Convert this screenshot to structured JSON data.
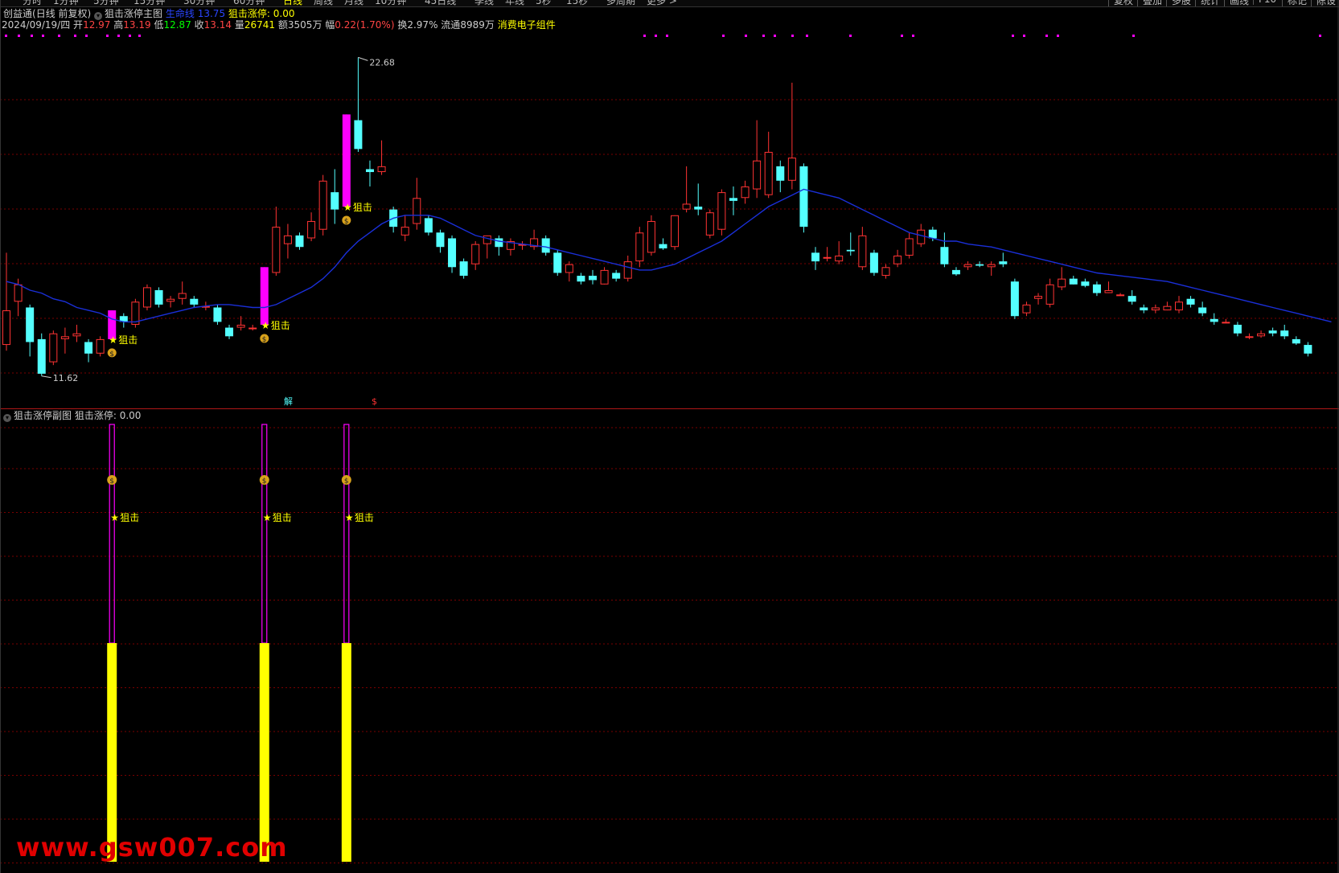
{
  "toolbar": {
    "tabs": [
      "分时",
      "1分钟",
      "5分钟",
      "15分钟",
      "30分钟",
      "60分钟",
      "日线",
      "周线",
      "月线",
      "10分钟",
      "45日线",
      "季线",
      "年线",
      "5秒",
      "15秒",
      "多周期",
      "更多 >"
    ],
    "active_tab": "日线",
    "right_buttons": [
      "复权",
      "叠加",
      "多股",
      "统计",
      "画线",
      "F10",
      "标记",
      "陈设"
    ]
  },
  "header": {
    "app": "创益通",
    "mode": "(日线 前复权)",
    "indicator": "狙击涨停主图",
    "lifeline_label": "生命线",
    "lifeline_value": "13.75",
    "signal_label": "狙击涨停:",
    "signal_value": "0.00",
    "date": "2024/09/19/四",
    "open_label": "开",
    "open": "12.97",
    "high_label": "高",
    "high": "13.19",
    "low_label": "低",
    "low": "12.87",
    "close_label": "收",
    "close": "13.14",
    "volume_label": "量",
    "volume": "26741",
    "amount_label": "额",
    "amount": "3505万",
    "change_label": "幅",
    "change": "0.22(1.70%)",
    "turnover_label": "换",
    "turnover": "2.97%",
    "float_label": "流通",
    "float": "8989万",
    "sector": "消费电子组件"
  },
  "sub_header": {
    "indicator": "狙击涨停副图",
    "signal_label": "狙击涨停:",
    "signal_value": "0.00"
  },
  "markers": {
    "jie": "解",
    "dollar": "$",
    "signal_text": "狙击",
    "star": "★",
    "max_price": "22.68",
    "min_price": "11.62"
  },
  "watermark": "www.gsw007.com",
  "colors": {
    "up": "#ff3333",
    "down": "#54ffff",
    "limit_up": "#ff00ff",
    "lifeline": "#1a2fd8",
    "signal_text": "#ffff00",
    "sub_bar": "#ffff00",
    "grid": "#7a0000"
  },
  "chart_data": {
    "type": "candlestick",
    "title": "狙击涨停主图",
    "ylim": [
      11.0,
      23.5
    ],
    "candles": [
      {
        "o": 12.7,
        "h": 15.9,
        "l": 12.5,
        "c": 13.9
      },
      {
        "o": 14.2,
        "h": 15.0,
        "l": 13.7,
        "c": 14.8
      },
      {
        "o": 14.0,
        "h": 14.1,
        "l": 12.3,
        "c": 12.8
      },
      {
        "o": 12.9,
        "h": 13.1,
        "l": 11.62,
        "c": 11.7
      },
      {
        "o": 12.1,
        "h": 13.2,
        "l": 12.0,
        "c": 13.1
      },
      {
        "o": 12.9,
        "h": 13.3,
        "l": 12.4,
        "c": 13.0
      },
      {
        "o": 13.0,
        "h": 13.4,
        "l": 12.8,
        "c": 13.1
      },
      {
        "o": 12.8,
        "h": 12.9,
        "l": 12.1,
        "c": 12.4
      },
      {
        "o": 12.4,
        "h": 13.0,
        "l": 12.3,
        "c": 12.9
      },
      {
        "o": 12.9,
        "h": 13.9,
        "l": 12.8,
        "c": 13.9,
        "limit": true
      },
      {
        "o": 13.7,
        "h": 13.8,
        "l": 13.3,
        "c": 13.5
      },
      {
        "o": 13.4,
        "h": 14.3,
        "l": 13.3,
        "c": 14.2
      },
      {
        "o": 14.0,
        "h": 14.8,
        "l": 13.9,
        "c": 14.7
      },
      {
        "o": 14.6,
        "h": 14.7,
        "l": 14.0,
        "c": 14.1
      },
      {
        "o": 14.2,
        "h": 14.4,
        "l": 14.0,
        "c": 14.3
      },
      {
        "o": 14.3,
        "h": 14.9,
        "l": 14.1,
        "c": 14.5
      },
      {
        "o": 14.3,
        "h": 14.4,
        "l": 14.0,
        "c": 14.1
      },
      {
        "o": 14.0,
        "h": 14.2,
        "l": 13.9,
        "c": 14.05
      },
      {
        "o": 14.0,
        "h": 14.1,
        "l": 13.4,
        "c": 13.5
      },
      {
        "o": 13.3,
        "h": 13.4,
        "l": 12.9,
        "c": 13.0
      },
      {
        "o": 13.3,
        "h": 13.7,
        "l": 13.2,
        "c": 13.4
      },
      {
        "o": 13.3,
        "h": 13.4,
        "l": 13.2,
        "c": 13.3
      },
      {
        "o": 13.4,
        "h": 15.4,
        "l": 13.3,
        "c": 15.4,
        "limit": true
      },
      {
        "o": 15.2,
        "h": 17.5,
        "l": 15.1,
        "c": 16.8
      },
      {
        "o": 16.2,
        "h": 16.9,
        "l": 15.7,
        "c": 16.5
      },
      {
        "o": 16.5,
        "h": 16.6,
        "l": 16.0,
        "c": 16.1
      },
      {
        "o": 16.4,
        "h": 17.3,
        "l": 16.3,
        "c": 17.0
      },
      {
        "o": 16.7,
        "h": 18.6,
        "l": 16.5,
        "c": 18.4
      },
      {
        "o": 18.0,
        "h": 18.8,
        "l": 16.9,
        "c": 17.4
      },
      {
        "o": 17.5,
        "h": 20.7,
        "l": 17.4,
        "c": 20.7,
        "limit": true
      },
      {
        "o": 20.5,
        "h": 22.68,
        "l": 19.4,
        "c": 19.5
      },
      {
        "o": 18.8,
        "h": 19.1,
        "l": 18.2,
        "c": 18.7
      },
      {
        "o": 18.7,
        "h": 19.8,
        "l": 18.6,
        "c": 18.9
      },
      {
        "o": 17.4,
        "h": 17.5,
        "l": 16.6,
        "c": 16.8
      },
      {
        "o": 16.5,
        "h": 17.2,
        "l": 16.3,
        "c": 16.8
      },
      {
        "o": 16.9,
        "h": 18.5,
        "l": 16.7,
        "c": 17.8
      },
      {
        "o": 17.1,
        "h": 17.2,
        "l": 16.5,
        "c": 16.6
      },
      {
        "o": 16.6,
        "h": 16.7,
        "l": 15.9,
        "c": 16.1
      },
      {
        "o": 16.4,
        "h": 16.5,
        "l": 15.2,
        "c": 15.4
      },
      {
        "o": 15.6,
        "h": 15.7,
        "l": 15.0,
        "c": 15.1
      },
      {
        "o": 15.5,
        "h": 16.3,
        "l": 15.3,
        "c": 16.2
      },
      {
        "o": 16.2,
        "h": 16.5,
        "l": 15.7,
        "c": 16.5
      },
      {
        "o": 16.4,
        "h": 16.5,
        "l": 15.8,
        "c": 16.1
      },
      {
        "o": 16.0,
        "h": 16.4,
        "l": 15.8,
        "c": 16.3
      },
      {
        "o": 16.2,
        "h": 16.3,
        "l": 16.0,
        "c": 16.2
      },
      {
        "o": 16.1,
        "h": 16.7,
        "l": 16.0,
        "c": 16.4
      },
      {
        "o": 16.4,
        "h": 16.5,
        "l": 15.8,
        "c": 15.9
      },
      {
        "o": 15.9,
        "h": 16.0,
        "l": 15.1,
        "c": 15.2
      },
      {
        "o": 15.2,
        "h": 15.6,
        "l": 14.9,
        "c": 15.5
      },
      {
        "o": 15.1,
        "h": 15.2,
        "l": 14.8,
        "c": 14.9
      },
      {
        "o": 15.1,
        "h": 15.3,
        "l": 14.8,
        "c": 14.95
      },
      {
        "o": 14.8,
        "h": 15.4,
        "l": 14.8,
        "c": 15.3
      },
      {
        "o": 15.2,
        "h": 15.3,
        "l": 14.9,
        "c": 15.0
      },
      {
        "o": 15.0,
        "h": 15.8,
        "l": 14.9,
        "c": 15.6
      },
      {
        "o": 15.6,
        "h": 16.8,
        "l": 15.4,
        "c": 16.6
      },
      {
        "o": 15.9,
        "h": 17.2,
        "l": 15.8,
        "c": 17.0
      },
      {
        "o": 16.2,
        "h": 16.4,
        "l": 16.0,
        "c": 16.05
      },
      {
        "o": 16.1,
        "h": 17.2,
        "l": 16.0,
        "c": 17.2
      },
      {
        "o": 17.4,
        "h": 18.9,
        "l": 17.3,
        "c": 17.6
      },
      {
        "o": 17.5,
        "h": 18.3,
        "l": 17.2,
        "c": 17.4
      },
      {
        "o": 16.5,
        "h": 17.4,
        "l": 16.4,
        "c": 17.3
      },
      {
        "o": 16.7,
        "h": 18.1,
        "l": 16.5,
        "c": 18.0
      },
      {
        "o": 17.8,
        "h": 18.2,
        "l": 17.2,
        "c": 17.7
      },
      {
        "o": 17.8,
        "h": 18.4,
        "l": 17.6,
        "c": 18.2
      },
      {
        "o": 18.1,
        "h": 20.5,
        "l": 17.8,
        "c": 19.1
      },
      {
        "o": 17.9,
        "h": 20.1,
        "l": 17.8,
        "c": 19.4
      },
      {
        "o": 18.9,
        "h": 19.1,
        "l": 18.0,
        "c": 18.4
      },
      {
        "o": 18.4,
        "h": 21.8,
        "l": 18.1,
        "c": 19.2
      },
      {
        "o": 18.9,
        "h": 19.0,
        "l": 16.6,
        "c": 16.8
      },
      {
        "o": 15.9,
        "h": 16.1,
        "l": 15.3,
        "c": 15.6
      },
      {
        "o": 15.7,
        "h": 16.1,
        "l": 15.6,
        "c": 15.75
      },
      {
        "o": 15.6,
        "h": 16.3,
        "l": 15.5,
        "c": 15.8
      },
      {
        "o": 16.0,
        "h": 16.6,
        "l": 15.8,
        "c": 15.95
      },
      {
        "o": 15.4,
        "h": 16.8,
        "l": 15.3,
        "c": 16.5
      },
      {
        "o": 15.9,
        "h": 16.0,
        "l": 15.1,
        "c": 15.2
      },
      {
        "o": 15.1,
        "h": 15.5,
        "l": 15.0,
        "c": 15.4
      },
      {
        "o": 15.5,
        "h": 16.0,
        "l": 15.4,
        "c": 15.8
      },
      {
        "o": 15.8,
        "h": 16.6,
        "l": 15.7,
        "c": 16.4
      },
      {
        "o": 16.2,
        "h": 16.9,
        "l": 16.1,
        "c": 16.7
      },
      {
        "o": 16.7,
        "h": 16.8,
        "l": 16.3,
        "c": 16.4
      },
      {
        "o": 16.1,
        "h": 16.6,
        "l": 15.4,
        "c": 15.5
      },
      {
        "o": 15.3,
        "h": 15.4,
        "l": 15.1,
        "c": 15.15
      },
      {
        "o": 15.4,
        "h": 15.6,
        "l": 15.3,
        "c": 15.5
      },
      {
        "o": 15.5,
        "h": 15.6,
        "l": 15.4,
        "c": 15.45
      },
      {
        "o": 15.4,
        "h": 15.6,
        "l": 15.1,
        "c": 15.5
      },
      {
        "o": 15.6,
        "h": 15.9,
        "l": 15.4,
        "c": 15.5
      },
      {
        "o": 14.9,
        "h": 15.0,
        "l": 13.6,
        "c": 13.7
      },
      {
        "o": 13.8,
        "h": 14.2,
        "l": 13.7,
        "c": 14.1
      },
      {
        "o": 14.3,
        "h": 14.5,
        "l": 14.1,
        "c": 14.4
      },
      {
        "o": 14.1,
        "h": 15.0,
        "l": 14.0,
        "c": 14.8
      },
      {
        "o": 14.7,
        "h": 15.4,
        "l": 14.6,
        "c": 15.0
      },
      {
        "o": 15.0,
        "h": 15.1,
        "l": 14.8,
        "c": 14.8
      },
      {
        "o": 14.9,
        "h": 15.0,
        "l": 14.7,
        "c": 14.75
      },
      {
        "o": 14.8,
        "h": 14.9,
        "l": 14.4,
        "c": 14.5
      },
      {
        "o": 14.5,
        "h": 14.9,
        "l": 14.5,
        "c": 14.6
      },
      {
        "o": 14.4,
        "h": 14.5,
        "l": 14.4,
        "c": 14.45
      },
      {
        "o": 14.4,
        "h": 14.6,
        "l": 14.1,
        "c": 14.2
      },
      {
        "o": 14.0,
        "h": 14.1,
        "l": 13.8,
        "c": 13.9
      },
      {
        "o": 13.9,
        "h": 14.1,
        "l": 13.8,
        "c": 14.0
      },
      {
        "o": 13.9,
        "h": 14.2,
        "l": 13.9,
        "c": 14.05
      },
      {
        "o": 13.9,
        "h": 14.4,
        "l": 13.8,
        "c": 14.2
      },
      {
        "o": 14.3,
        "h": 14.4,
        "l": 14.0,
        "c": 14.1
      },
      {
        "o": 14.0,
        "h": 14.2,
        "l": 13.7,
        "c": 13.8
      },
      {
        "o": 13.6,
        "h": 13.8,
        "l": 13.4,
        "c": 13.5
      },
      {
        "o": 13.5,
        "h": 13.6,
        "l": 13.45,
        "c": 13.5
      },
      {
        "o": 13.4,
        "h": 13.5,
        "l": 13.0,
        "c": 13.1
      },
      {
        "o": 13.0,
        "h": 13.1,
        "l": 12.9,
        "c": 13.0
      },
      {
        "o": 13.0,
        "h": 13.2,
        "l": 12.95,
        "c": 13.1
      },
      {
        "o": 13.2,
        "h": 13.3,
        "l": 13.0,
        "c": 13.1
      },
      {
        "o": 13.2,
        "h": 13.4,
        "l": 12.9,
        "c": 13.0
      },
      {
        "o": 12.9,
        "h": 13.0,
        "l": 12.7,
        "c": 12.75
      },
      {
        "o": 12.7,
        "h": 12.8,
        "l": 12.3,
        "c": 12.4
      }
    ],
    "lifeline": [
      14.9,
      14.8,
      14.6,
      14.5,
      14.3,
      14.2,
      14.0,
      13.9,
      13.8,
      13.6,
      13.5,
      13.5,
      13.6,
      13.7,
      13.8,
      13.9,
      14.0,
      14.05,
      14.1,
      14.1,
      14.05,
      14.0,
      14.0,
      14.1,
      14.3,
      14.5,
      14.7,
      15.0,
      15.4,
      15.9,
      16.3,
      16.6,
      16.9,
      17.1,
      17.2,
      17.2,
      17.2,
      17.1,
      16.9,
      16.7,
      16.5,
      16.4,
      16.3,
      16.25,
      16.2,
      16.15,
      16.1,
      16.0,
      15.9,
      15.8,
      15.7,
      15.6,
      15.5,
      15.4,
      15.3,
      15.3,
      15.4,
      15.5,
      15.7,
      15.9,
      16.1,
      16.3,
      16.6,
      16.9,
      17.2,
      17.5,
      17.7,
      17.9,
      18.1,
      18.0,
      17.9,
      17.8,
      17.6,
      17.4,
      17.2,
      17.0,
      16.8,
      16.6,
      16.5,
      16.4,
      16.3,
      16.3,
      16.2,
      16.15,
      16.1,
      16.0,
      15.9,
      15.8,
      15.7,
      15.6,
      15.5,
      15.4,
      15.3,
      15.2,
      15.15,
      15.1,
      15.05,
      15.0,
      14.95,
      14.9,
      14.8,
      14.7,
      14.6,
      14.5,
      14.4,
      14.3,
      14.2,
      14.1,
      14.0,
      13.9,
      13.8,
      13.7,
      13.6,
      13.5
    ],
    "signals": [
      9,
      22,
      29
    ],
    "sub_panel": {
      "title": "狙击涨停副图",
      "signal_value": 0.0,
      "bars": [
        {
          "index": 9,
          "value": 1
        },
        {
          "index": 22,
          "value": 1
        },
        {
          "index": 29,
          "value": 1
        }
      ]
    }
  }
}
